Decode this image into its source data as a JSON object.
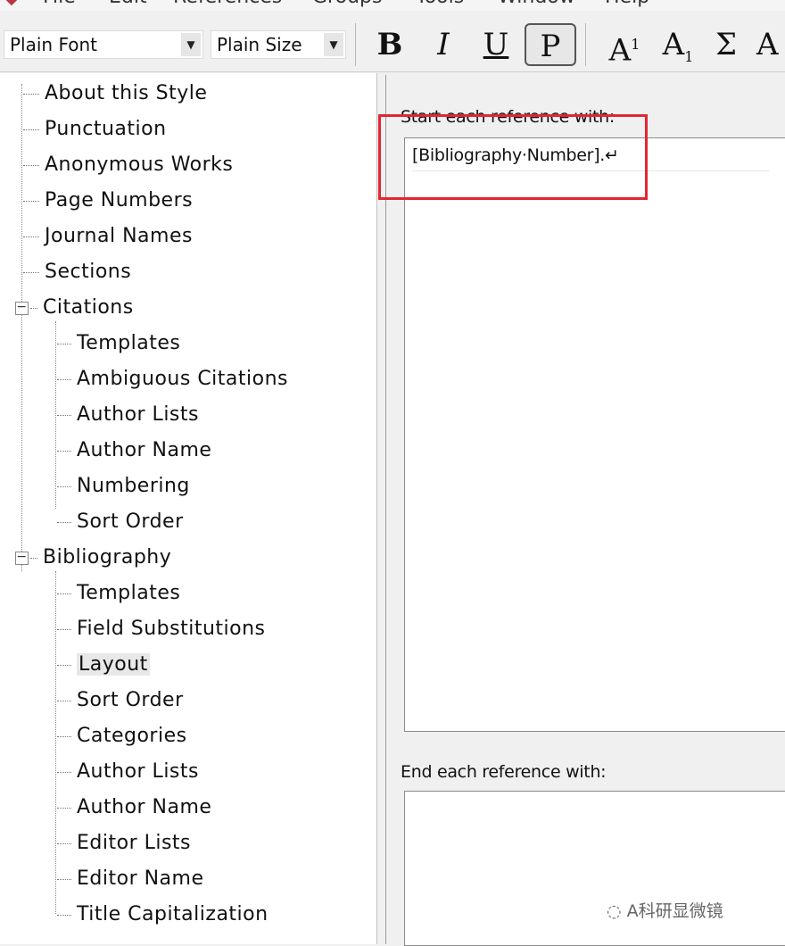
{
  "menu": {
    "items": [
      "File",
      "Edit",
      "References",
      "Groups",
      "Tools",
      "Window",
      "Help"
    ]
  },
  "toolbar": {
    "font_value": "Plain Font",
    "size_value": "Plain Size",
    "bold": "B",
    "italic": "I",
    "underline": "U",
    "plain": "P",
    "superscript_base": "A",
    "superscript_mark": "1",
    "subscript_base": "A",
    "subscript_mark": "1",
    "symbol": "Σ",
    "small_caps": "A"
  },
  "tree": {
    "top_items": [
      "About this Style",
      "Punctuation",
      "Anonymous Works",
      "Page Numbers",
      "Journal Names",
      "Sections"
    ],
    "citations": {
      "label": "Citations",
      "children": [
        "Templates",
        "Ambiguous Citations",
        "Author Lists",
        "Author Name",
        "Numbering",
        "Sort Order"
      ]
    },
    "bibliography": {
      "label": "Bibliography",
      "children": [
        "Templates",
        "Field Substitutions",
        "Layout",
        "Sort Order",
        "Categories",
        "Author Lists",
        "Author Name",
        "Editor Lists",
        "Editor Name",
        "Title Capitalization"
      ],
      "selected": "Layout"
    }
  },
  "layout": {
    "start_label": "Start each reference with:",
    "start_value": "[Bibliography·Number].↵",
    "end_label": "End each reference with:",
    "end_value": ""
  },
  "watermark": "A科研显微镜",
  "colors": {
    "highlight": "#e32632",
    "selected_bg": "#e8e8e8"
  }
}
